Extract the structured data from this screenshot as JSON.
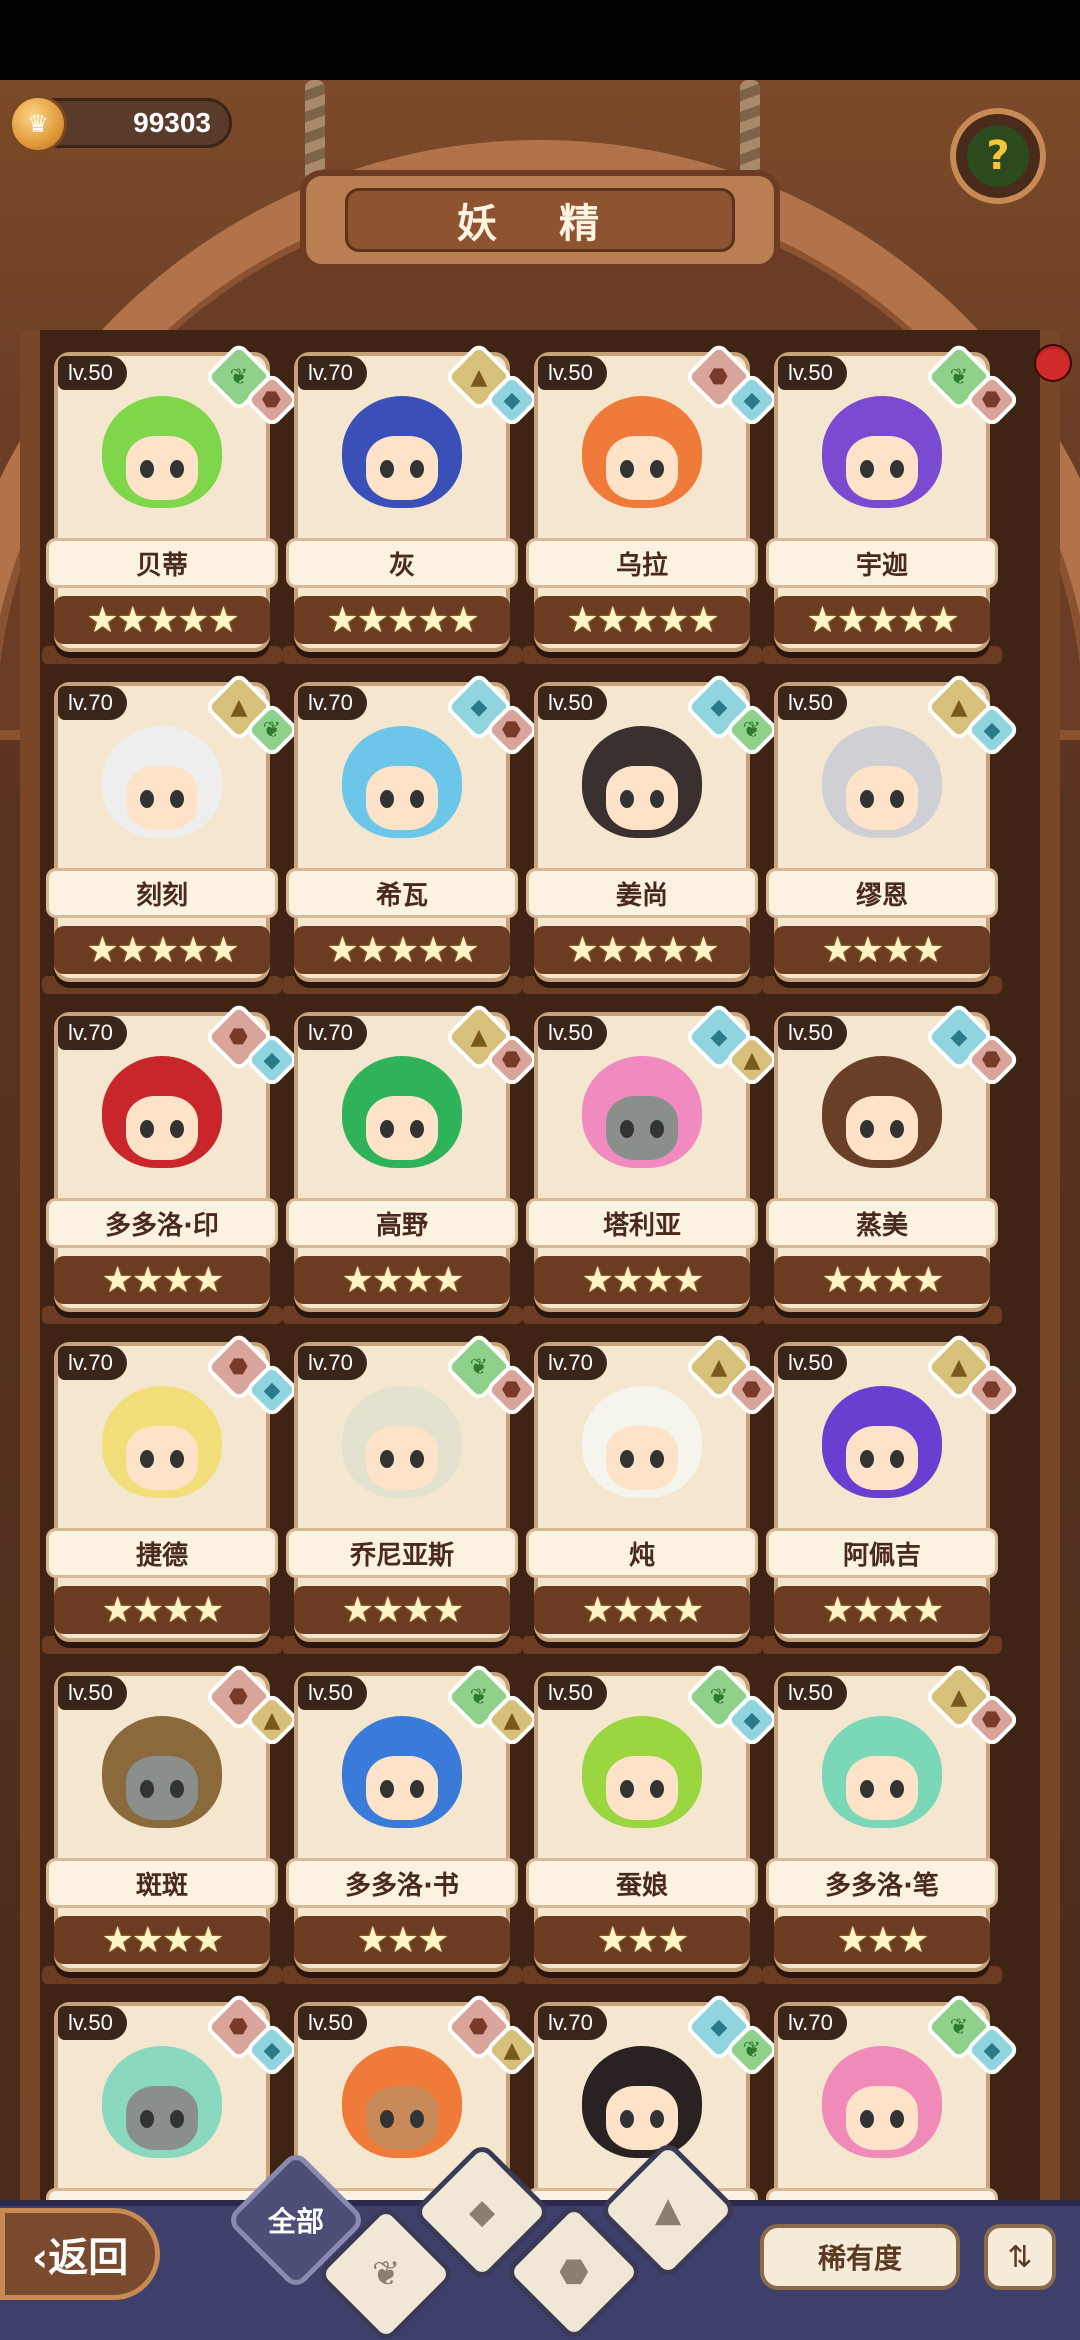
{
  "header": {
    "currency_value": "99303",
    "currency_icon": "coin-icon",
    "title": "妖 精",
    "help_icon": "question-sprout-icon"
  },
  "fairies": [
    {
      "level": "lv.50",
      "name": "贝蒂",
      "stars": "★★★★★",
      "elements": [
        "plant",
        "rock"
      ],
      "hair": "#7fd64a",
      "face": "light"
    },
    {
      "level": "lv.70",
      "name": "灰",
      "stars": "★★★★★",
      "elements": [
        "earth",
        "water"
      ],
      "hair": "#3b4fb8",
      "face": "light"
    },
    {
      "level": "lv.50",
      "name": "乌拉",
      "stars": "★★★★★",
      "elements": [
        "rock",
        "water"
      ],
      "hair": "#f07a3a",
      "face": "light"
    },
    {
      "level": "lv.50",
      "name": "宇迦",
      "stars": "★★★★★",
      "elements": [
        "plant",
        "rock"
      ],
      "hair": "#7a4ad0",
      "face": "light"
    },
    {
      "level": "lv.70",
      "name": "刻刻",
      "stars": "★★★★★",
      "elements": [
        "earth",
        "plant"
      ],
      "hair": "#eeeeee",
      "face": "light"
    },
    {
      "level": "lv.70",
      "name": "希瓦",
      "stars": "★★★★★",
      "elements": [
        "water",
        "rock"
      ],
      "hair": "#6cc6ea",
      "face": "light"
    },
    {
      "level": "lv.50",
      "name": "姜尚",
      "stars": "★★★★★",
      "elements": [
        "water",
        "plant"
      ],
      "hair": "#3a3030",
      "face": "light"
    },
    {
      "level": "lv.50",
      "name": "缪恩",
      "stars": "★★★★",
      "elements": [
        "earth",
        "water"
      ],
      "hair": "#cfcfd6",
      "face": "light"
    },
    {
      "level": "lv.70",
      "name": "多多洛·印",
      "stars": "★★★★",
      "elements": [
        "rock",
        "water"
      ],
      "hair": "#c8262a",
      "face": "light"
    },
    {
      "level": "lv.70",
      "name": "高野",
      "stars": "★★★★",
      "elements": [
        "earth",
        "rock"
      ],
      "hair": "#2fb35a",
      "face": "light"
    },
    {
      "level": "lv.50",
      "name": "塔利亚",
      "stars": "★★★★",
      "elements": [
        "water",
        "earth"
      ],
      "hair": "#f08ac0",
      "face": "gray"
    },
    {
      "level": "lv.50",
      "name": "蒸美",
      "stars": "★★★★",
      "elements": [
        "water",
        "rock"
      ],
      "hair": "#6a3f28",
      "face": "light"
    },
    {
      "level": "lv.70",
      "name": "捷德",
      "stars": "★★★★",
      "elements": [
        "rock",
        "water"
      ],
      "hair": "#f2df7a",
      "face": "light"
    },
    {
      "level": "lv.70",
      "name": "乔尼亚斯",
      "stars": "★★★★",
      "elements": [
        "plant",
        "rock"
      ],
      "hair": "#e2e2cf",
      "face": "light"
    },
    {
      "level": "lv.70",
      "name": "炖",
      "stars": "★★★★",
      "elements": [
        "earth",
        "rock"
      ],
      "hair": "#f5f5ee",
      "face": "light"
    },
    {
      "level": "lv.50",
      "name": "阿佩吉",
      "stars": "★★★★",
      "elements": [
        "earth",
        "rock"
      ],
      "hair": "#6a3ed0",
      "face": "light"
    },
    {
      "level": "lv.50",
      "name": "斑斑",
      "stars": "★★★★",
      "elements": [
        "rock",
        "earth"
      ],
      "hair": "#8a6a3a",
      "face": "gray"
    },
    {
      "level": "lv.50",
      "name": "多多洛·书",
      "stars": "★★★",
      "elements": [
        "plant",
        "earth"
      ],
      "hair": "#3a7ad8",
      "face": "light"
    },
    {
      "level": "lv.50",
      "name": "蚕娘",
      "stars": "★★★",
      "elements": [
        "plant",
        "water"
      ],
      "hair": "#9ad640",
      "face": "light"
    },
    {
      "level": "lv.50",
      "name": "多多洛·笔",
      "stars": "★★★",
      "elements": [
        "earth",
        "rock"
      ],
      "hair": "#7ad8b8",
      "face": "light"
    },
    {
      "level": "lv.50",
      "name": "",
      "stars": "",
      "elements": [
        "rock",
        "water"
      ],
      "hair": "#8ad8c0",
      "face": "gray"
    },
    {
      "level": "lv.50",
      "name": "",
      "stars": "",
      "elements": [
        "rock",
        "earth"
      ],
      "hair": "#f07a3a",
      "face": "brown"
    },
    {
      "level": "lv.70",
      "name": "",
      "stars": "",
      "elements": [
        "water",
        "plant"
      ],
      "hair": "#2a2222",
      "face": "light"
    },
    {
      "level": "lv.70",
      "name": "",
      "stars": "",
      "elements": [
        "plant",
        "water"
      ],
      "hair": "#f08ab8",
      "face": "light"
    }
  ],
  "element_icons": {
    "plant": "❦",
    "earth": "▲",
    "water": "◆",
    "rock": "⬣"
  },
  "bottom": {
    "back_label": "‹返回",
    "filter_all_label": "全部",
    "filters": [
      "plant",
      "water",
      "rock",
      "earth"
    ],
    "sort_label": "稀有度",
    "order_icon": "sort-order-icon",
    "order_glyph": "⇅"
  }
}
